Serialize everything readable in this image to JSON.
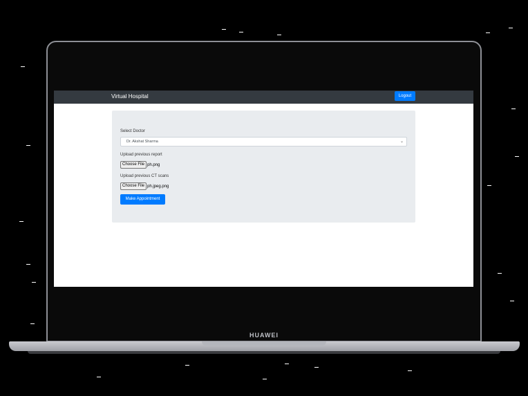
{
  "device": {
    "brand_logo": "HUAWEI"
  },
  "navbar": {
    "brand": "Virtual Hospital",
    "logout_label": "Logout"
  },
  "form": {
    "doctor_label": "Select Doctor",
    "doctor_selected": "Dr. Akshat Sharma",
    "report_label": "Upload previous report",
    "report_button": "Choose File",
    "report_file": "ph.png",
    "ct_label": "Upload previous CT scans",
    "ct_button": "Choose File",
    "ct_file": "ph.jpeg.png",
    "submit_label": "Make Appointment"
  },
  "colors": {
    "navbar_bg": "#343a40",
    "primary": "#007bff",
    "panel_bg": "#e9ecef"
  },
  "icons": {
    "select_chevron": "chevron-down-icon"
  }
}
